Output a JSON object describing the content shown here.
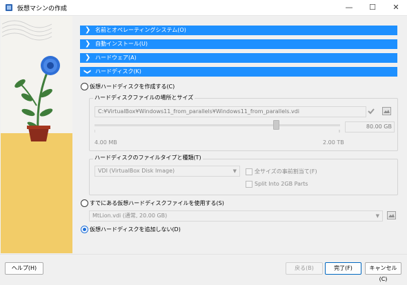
{
  "window": {
    "title": "仮想マシンの作成",
    "min_glyph": "—",
    "max_glyph": "☐",
    "close_glyph": "✕"
  },
  "sections": [
    {
      "label": "名前とオペレーティングシステム(O)",
      "expanded": false
    },
    {
      "label": "自動インストール(U)",
      "expanded": false
    },
    {
      "label": "ハードウェア(A)",
      "expanded": false
    },
    {
      "label": "ハードディスク(K)",
      "expanded": true
    }
  ],
  "chevrons": {
    "collapsed": "❯",
    "expanded": "❯"
  },
  "harddisk": {
    "create_new": {
      "label": "仮想ハードディスクを作成する(C)",
      "selected": false
    },
    "location_group": {
      "title": "ハードディスクファイルの場所とサイズ",
      "path": "C:¥VirtualBox¥Windows11_from_parallels¥Windows11_from_parallels.vdi",
      "size_value": "80.00 GB",
      "min_label": "4.00 MB",
      "max_label": "2.00 TB",
      "slider_fraction": 0.74
    },
    "type_group": {
      "title": "ハードディスクのファイルタイプと種類(T)",
      "type_value": "VDI (VirtualBox Disk Image)",
      "preallocate_label": "全サイズの事前割当て(F)",
      "split_label": "Split Into 2GB Parts"
    },
    "use_existing": {
      "label": "すでにある仮想ハードディスクファイルを使用する(S)",
      "selected": false,
      "file_value": "MtLion.vdi (通常, 20.00 GB)"
    },
    "none": {
      "label": "仮想ハードディスクを追加しない(D)",
      "selected": true
    }
  },
  "buttons": {
    "help": "ヘルプ(H)",
    "back": "戻る(B)",
    "finish": "完了(F)",
    "cancel": "キャンセル(C)"
  },
  "colors": {
    "accent": "#1e90ff",
    "floor": "#f2cc68",
    "pot": "#8b2c1c",
    "flower": "#2f6fd6",
    "leaf": "#3f7d3a"
  }
}
